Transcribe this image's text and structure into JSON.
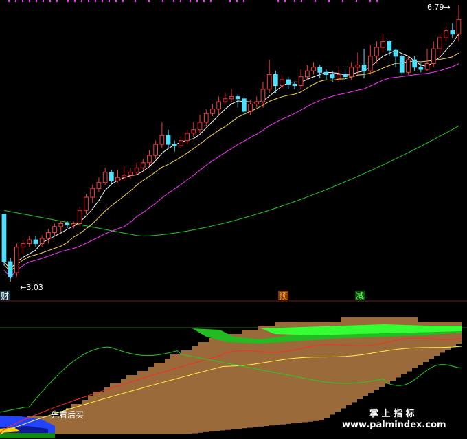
{
  "chart_data": [
    {
      "type": "candlestick",
      "panel": "price",
      "annotations": {
        "low_label": "3.03",
        "high_label": "6.79",
        "markers": [
          "财",
          "预",
          "减"
        ]
      },
      "colors": {
        "up": "#ff3b3b",
        "down": "#4fe0ff",
        "ma5": "#ffffff",
        "ma10": "#ffd84a",
        "ma20": "#ff33ff",
        "ma60": "#22cc22"
      },
      "candles": [
        [
          3.95,
          3.3,
          3.95,
          3.25
        ],
        [
          3.3,
          3.1,
          3.35,
          3.03
        ],
        [
          3.15,
          3.5,
          3.55,
          3.1
        ],
        [
          3.5,
          3.55,
          3.6,
          3.4
        ],
        [
          3.55,
          3.6,
          3.65,
          3.5
        ],
        [
          3.6,
          3.55,
          3.65,
          3.5
        ],
        [
          3.55,
          3.62,
          3.66,
          3.5
        ],
        [
          3.62,
          3.7,
          3.75,
          3.55
        ],
        [
          3.7,
          3.78,
          3.82,
          3.65
        ],
        [
          3.78,
          3.82,
          3.86,
          3.7
        ],
        [
          3.82,
          3.8,
          3.86,
          3.76
        ],
        [
          3.8,
          3.82,
          3.85,
          3.75
        ],
        [
          3.82,
          4.0,
          4.05,
          3.78
        ],
        [
          4.0,
          4.18,
          4.22,
          3.95
        ],
        [
          4.18,
          4.3,
          4.35,
          4.1
        ],
        [
          4.3,
          4.38,
          4.45,
          4.25
        ],
        [
          4.38,
          4.52,
          4.58,
          4.35
        ],
        [
          4.52,
          4.4,
          4.55,
          4.35
        ],
        [
          4.4,
          4.45,
          4.55,
          4.38
        ],
        [
          4.45,
          4.48,
          4.6,
          4.4
        ],
        [
          4.48,
          4.52,
          4.58,
          4.42
        ],
        [
          4.52,
          4.58,
          4.65,
          4.48
        ],
        [
          4.58,
          4.65,
          4.7,
          4.55
        ],
        [
          4.65,
          4.75,
          4.82,
          4.6
        ],
        [
          4.75,
          4.9,
          4.95,
          4.7
        ],
        [
          4.9,
          5.02,
          5.2,
          4.85
        ],
        [
          5.02,
          4.9,
          5.1,
          4.85
        ],
        [
          4.9,
          4.88,
          4.95,
          4.8
        ],
        [
          4.88,
          4.95,
          5.0,
          4.85
        ],
        [
          4.95,
          5.05,
          5.1,
          4.9
        ],
        [
          5.05,
          5.1,
          5.2,
          5.0
        ],
        [
          5.1,
          5.2,
          5.3,
          5.05
        ],
        [
          5.2,
          5.32,
          5.38,
          5.15
        ],
        [
          5.32,
          5.38,
          5.45,
          5.28
        ],
        [
          5.38,
          5.48,
          5.55,
          5.3
        ],
        [
          5.48,
          5.52,
          5.6,
          5.45
        ],
        [
          5.52,
          5.55,
          5.65,
          5.48
        ],
        [
          5.55,
          5.52,
          5.58,
          5.4
        ],
        [
          5.52,
          5.35,
          5.55,
          5.3
        ],
        [
          5.35,
          5.45,
          5.5,
          5.3
        ],
        [
          5.45,
          5.48,
          5.55,
          5.4
        ],
        [
          5.48,
          5.65,
          5.75,
          5.4
        ],
        [
          5.65,
          5.85,
          6.05,
          5.6
        ],
        [
          5.85,
          5.7,
          5.9,
          5.6
        ],
        [
          5.7,
          5.78,
          5.85,
          5.65
        ],
        [
          5.78,
          5.72,
          5.82,
          5.65
        ],
        [
          5.72,
          5.7,
          5.75,
          5.65
        ],
        [
          5.7,
          5.82,
          5.92,
          5.65
        ],
        [
          5.82,
          5.9,
          5.98,
          5.78
        ],
        [
          5.9,
          5.95,
          6.02,
          5.85
        ],
        [
          5.95,
          5.88,
          5.98,
          5.8
        ],
        [
          5.88,
          5.85,
          5.92,
          5.78
        ],
        [
          5.85,
          5.8,
          5.9,
          5.75
        ],
        [
          5.8,
          5.85,
          5.95,
          5.75
        ],
        [
          5.85,
          5.82,
          5.92,
          5.78
        ],
        [
          5.82,
          5.95,
          6.02,
          5.78
        ],
        [
          5.95,
          5.98,
          6.15,
          5.85
        ],
        [
          5.98,
          5.9,
          6.2,
          5.8
        ],
        [
          5.9,
          6.1,
          6.25,
          5.85
        ],
        [
          6.1,
          6.22,
          6.3,
          6.0
        ],
        [
          6.22,
          6.3,
          6.4,
          6.15
        ],
        [
          6.3,
          6.18,
          6.32,
          6.1
        ],
        [
          6.18,
          6.1,
          6.2,
          5.95
        ],
        [
          6.1,
          5.88,
          6.12,
          5.85
        ],
        [
          5.88,
          6.05,
          6.1,
          5.85
        ],
        [
          6.05,
          5.95,
          6.1,
          5.9
        ],
        [
          5.95,
          5.92,
          6.0,
          5.88
        ],
        [
          5.92,
          6.0,
          6.2,
          5.9
        ],
        [
          6.0,
          6.2,
          6.3,
          5.95
        ],
        [
          6.2,
          6.35,
          6.4,
          6.1
        ],
        [
          6.35,
          6.45,
          6.5,
          6.3
        ],
        [
          6.45,
          6.4,
          6.55,
          6.35
        ],
        [
          6.4,
          6.6,
          6.79,
          6.3
        ]
      ]
    },
    {
      "type": "area",
      "panel": "indicator",
      "labels": {
        "signal": "先看后买",
        "watermark_cn": "掌 上 指 标",
        "watermark_url": "www.palmindex.com"
      },
      "colors": {
        "area": "#9a6a3a",
        "band": "#22bb22",
        "band2": "#33ff33",
        "red_line": "#ff2a2a",
        "yellow_line": "#ffee44",
        "green_line": "#22cc22"
      }
    }
  ]
}
